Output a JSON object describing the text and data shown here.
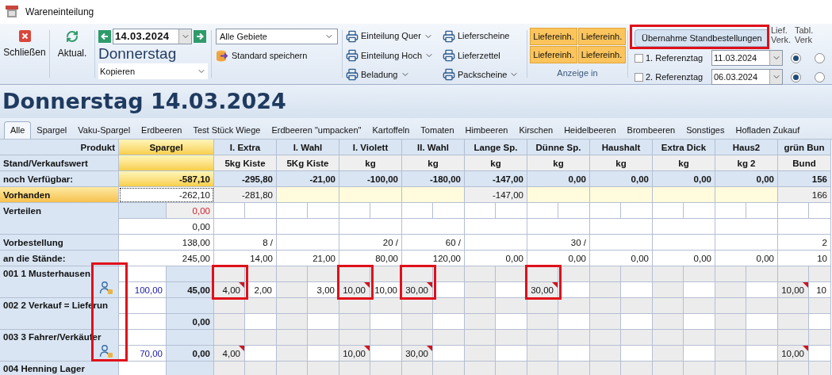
{
  "window": {
    "title": "Wareneinteilung"
  },
  "toolbar": {
    "close": {
      "label": "Schließen"
    },
    "refresh": {
      "label": "Aktual."
    },
    "date": {
      "value": "14.03.2024",
      "weekday": "Donnerstag"
    },
    "copy_select": {
      "value": "Kopieren"
    },
    "area_select": {
      "value": "Alle Gebiete"
    },
    "save_standard": {
      "label": "Standard speichern"
    },
    "print_buttons": [
      {
        "label": "Einteilung Quer",
        "dropdown": true
      },
      {
        "label": "Einteilung Hoch",
        "dropdown": true
      },
      {
        "label": "Beladung",
        "dropdown": true
      },
      {
        "label": "Lieferscheine",
        "dropdown": false
      },
      {
        "label": "Lieferzettel",
        "dropdown": false
      },
      {
        "label": "Packscheine",
        "dropdown": true
      }
    ],
    "unit_buttons": [
      "Liefereinh.",
      "Liefereinh.",
      "Liefereinh.",
      "Liefereinh."
    ],
    "unit_group_label": "Anzeige in",
    "adopt_button": {
      "label": "Übernahme Standbestellungen",
      "highlighted": true
    },
    "radio_headers": [
      "Lief. Verk.",
      "Tabl. Verk"
    ],
    "reference_days": [
      {
        "label": "1. Referenztag",
        "checked": false,
        "date": "11.03.2024",
        "options": [
          {
            "selected": true
          },
          {
            "selected": false
          }
        ]
      },
      {
        "label": "2. Referenztag",
        "checked": false,
        "date": "06.03.2024",
        "options": [
          {
            "selected": true
          },
          {
            "selected": false
          }
        ]
      }
    ]
  },
  "title": "Donnerstag 14.03.2024",
  "tabs": [
    {
      "label": "Alle",
      "selected": true
    },
    {
      "label": "Spargel",
      "selected": false
    },
    {
      "label": "Vaku-Spargel",
      "selected": false
    },
    {
      "label": "Erdbeeren",
      "selected": false
    },
    {
      "label": "Test Stück Wiege",
      "selected": false
    },
    {
      "label": "Erdbeeren \"umpacken\"",
      "selected": false
    },
    {
      "label": "Kartoffeln",
      "selected": false
    },
    {
      "label": "Tomaten",
      "selected": false
    },
    {
      "label": "Himbeeren",
      "selected": false
    },
    {
      "label": "Kirschen",
      "selected": false
    },
    {
      "label": "Heidelbeeren",
      "selected": false
    },
    {
      "label": "Brombeeren",
      "selected": false
    },
    {
      "label": "Sonstiges",
      "selected": false
    },
    {
      "label": "Hofladen Zukauf",
      "selected": false
    }
  ],
  "table": {
    "row_labels": [
      "Produkt",
      "Stand/Verkaufswert",
      "noch Verfügbar:",
      "Vorhanden",
      "Verteilen",
      "Vorbestellung",
      "an die Stände:"
    ],
    "summary": {
      "name": "Spargel",
      "available": "-587,10",
      "on_hand": "-262,10",
      "distribute": "0,00",
      "distribute_total": "0,00",
      "preorder": "138,00",
      "to_stands": "245,00"
    },
    "columns": [
      {
        "name": "I. Extra",
        "unit": "5kg Kiste",
        "available": "-295,80",
        "on_hand": "-281,80",
        "preorder": "8 /",
        "to_stands": "14,00"
      },
      {
        "name": "I. Wahl",
        "unit": "5Kg Kiste",
        "available": "-21,00",
        "to_stands": "21,00"
      },
      {
        "name": "I. Violett",
        "unit": "kg",
        "available": "-100,00",
        "preorder": "20 /",
        "to_stands": "80,00"
      },
      {
        "name": "II. Wahl",
        "unit": "kg",
        "available": "-180,00",
        "preorder": "60 /",
        "to_stands": "120,00"
      },
      {
        "name": "Lange Sp.",
        "unit": "kg",
        "available": "-147,00",
        "on_hand": "-147,00",
        "to_stands": "0,00"
      },
      {
        "name": "Dünne Sp.",
        "unit": "kg",
        "available": "0,00",
        "preorder": "30 /",
        "to_stands": "0,00"
      },
      {
        "name": "Haushalt",
        "unit": "kg",
        "available": "0,00",
        "to_stands": "0,00"
      },
      {
        "name": "Extra Dick",
        "unit": "kg",
        "available": "0,00",
        "to_stands": "0,00"
      },
      {
        "name": "Haus2",
        "unit": "kg 2",
        "available": "0,00",
        "to_stands": "0,00"
      },
      {
        "name": "grün Bun",
        "unit": "Bund",
        "available": "156",
        "on_hand": "166",
        "preorder": "2",
        "to_stands": "10"
      }
    ],
    "icon_column_highlighted": true,
    "stations": [
      {
        "name": "001 1 Musterhausen",
        "icon": true,
        "ordered": "100,00",
        "total": "45,00",
        "cells": [
          {
            "value": "4,00",
            "flagged": true,
            "highlighted": true
          },
          {
            "value": "2,00",
            "flagged": false,
            "highlighted": false
          },
          {},
          {
            "value": "3,00",
            "flagged": false,
            "highlighted": false
          },
          {
            "value": "10,00",
            "flagged": true,
            "highlighted": true
          },
          {
            "value": "10,00",
            "flagged": false,
            "highlighted": false
          },
          {
            "value": "30,00",
            "flagged": true,
            "highlighted": true
          },
          {},
          {},
          {},
          {
            "value": "30,00",
            "flagged": true,
            "highlighted": true
          },
          {},
          {},
          {},
          {},
          {},
          {},
          {},
          {
            "value": "10,00",
            "flagged": true,
            "highlighted": false
          },
          {
            "value": "10",
            "flagged": false,
            "highlighted": false
          }
        ]
      },
      {
        "name": "002 2 Verkauf = Lieferun",
        "icon": false,
        "total": "0,00"
      },
      {
        "name": "003 3 Fahrer/Verkäufer",
        "icon": true,
        "ordered": "70,00",
        "total": "0,00",
        "cells": [
          {
            "value": "4,00",
            "flagged": true,
            "highlighted": false
          },
          {},
          {},
          {},
          {
            "value": "10,00",
            "flagged": true,
            "highlighted": false
          },
          {},
          {
            "value": "30,00",
            "flagged": true,
            "highlighted": false
          },
          {},
          {},
          {},
          {},
          {},
          {},
          {},
          {},
          {},
          {},
          {},
          {
            "value": "10,00",
            "flagged": true,
            "highlighted": false
          },
          {}
        ]
      },
      {
        "name": "004 Henning Lager",
        "icon": false,
        "partial": true
      }
    ]
  }
}
